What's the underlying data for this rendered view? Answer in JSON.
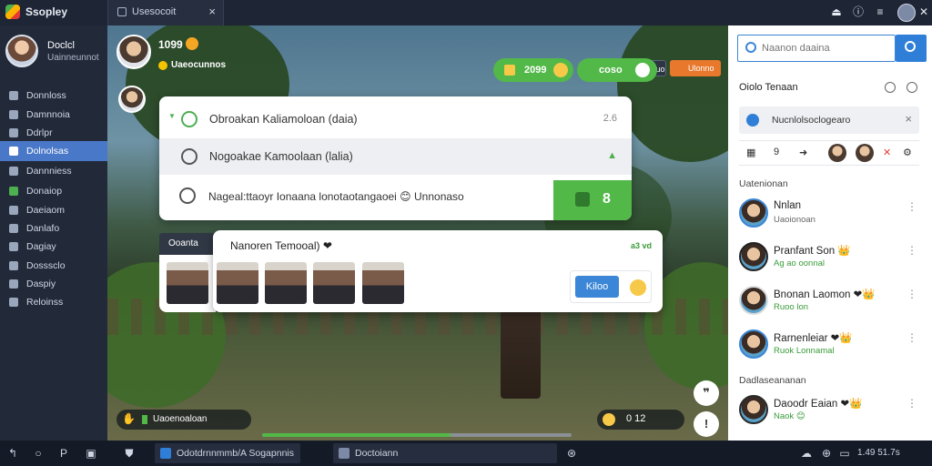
{
  "app": {
    "title": "Ssopley"
  },
  "tab": {
    "label": "Usesocoit",
    "close_icon": "×"
  },
  "topbar_icons": [
    "alert-icon",
    "info-icon",
    "menu-icon",
    "close-icon"
  ],
  "sidebar": {
    "profile": {
      "name": "Doclcl",
      "subtitle": "Uainneunnot"
    },
    "items": [
      {
        "label": "Donnloss",
        "icon": "home-icon",
        "active": false
      },
      {
        "label": "Damnnoia",
        "icon": "edit-icon",
        "active": false
      },
      {
        "label": "Ddrlpr",
        "icon": "settings-icon",
        "active": false
      },
      {
        "label": "Dolnolsas",
        "icon": "chat-icon",
        "active": true
      },
      {
        "label": "Dannniess",
        "icon": "user-icon",
        "active": false
      },
      {
        "label": "Donaiop",
        "icon": "games-icon",
        "active": false
      },
      {
        "label": "Daeiaom",
        "icon": "list-icon",
        "active": false
      },
      {
        "label": "Danlafo",
        "icon": "doc-icon",
        "active": false
      },
      {
        "label": "Dagiay",
        "icon": "grid-icon",
        "active": false
      },
      {
        "label": "Dosssclo",
        "icon": "grid-icon",
        "active": false
      },
      {
        "label": "Daspiy",
        "icon": "grid-icon",
        "active": false
      },
      {
        "label": "Reloinss",
        "icon": "grid-icon",
        "active": false
      }
    ]
  },
  "game": {
    "score": "1099",
    "status": "Uaeocunnos",
    "badge_dark": "Dmno csuo",
    "badge_orange": "Ulonno",
    "pill_1": "2099",
    "pill_2": "coso",
    "quests": [
      {
        "text": "Obroakan Kaliamoloan (daia)",
        "side": "2.6"
      },
      {
        "text": "Nogoakae Kamoolaan (lalia)",
        "side": "▲"
      },
      {
        "text": "Nageal:ttaoyr Ionaana lonotaotangaoei 😊  Unnonaso",
        "side": ""
      }
    ],
    "quest_count": "8",
    "party": {
      "label": "Ooanta",
      "title": "Nanoren Temooal) ❤",
      "count": "a3 vd",
      "invite": "Kiloo"
    },
    "hud_left": "Uaoenoaloan",
    "hud_right": "0  12",
    "progress": 0.61
  },
  "right_panel": {
    "search": {
      "placeholder": "Naanon daaina",
      "value": ""
    },
    "title": "Oiolo Tenaan",
    "chip": "Nucnlolsoclogearo",
    "controls": {
      "count": "9"
    },
    "section_1": "Uatenionan",
    "section_2": "Dadlaseananan",
    "friends": [
      {
        "name": "Nnlan",
        "sub": "Uaoionoan"
      },
      {
        "name": "Pranfant Son 👑",
        "sub": "Ag ao oonnal"
      },
      {
        "name": "Bnonan Laomon ❤👑",
        "sub": "Ruoo lon"
      },
      {
        "name": "Rarnenleiar ❤👑",
        "sub": "Ruok  Lonnamal"
      },
      {
        "name": "Daoodr Eaian ❤👑",
        "sub": "Naok 😊"
      }
    ]
  },
  "taskbar": {
    "task_1": "Odotdrnnmmb/A Sogapnnis",
    "task_2": "Doctoiann",
    "clock": "1.49 51.7s"
  }
}
